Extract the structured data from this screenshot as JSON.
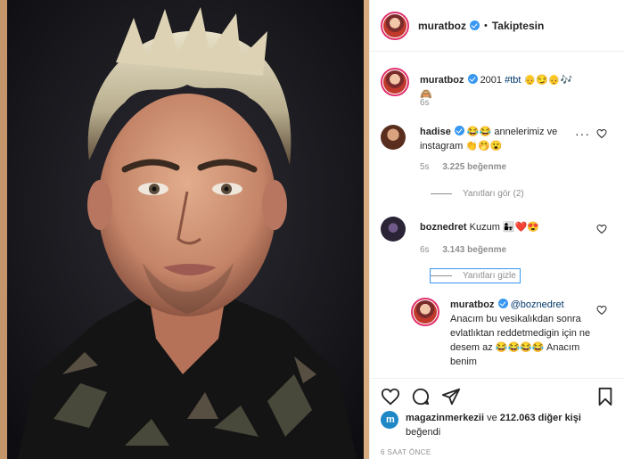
{
  "header": {
    "username": "muratboz",
    "separator": "•",
    "follow_label": "Takiptesin"
  },
  "caption": {
    "username": "muratboz",
    "text": "2001",
    "hashtag": "#tbt",
    "emoji": "👴😏👴🎶 🙈",
    "time": "6s"
  },
  "comments": [
    {
      "username": "hadise",
      "verified": true,
      "text": "😂😂 annelerimiz ve instagram 👏🤭😮",
      "time": "5s",
      "likes": "3.225 beğenme",
      "replies": "Yanıtları gör (2)"
    },
    {
      "username": "boznedret",
      "verified": false,
      "text": "Kuzum 👩‍👧❤️😍",
      "time": "6s",
      "likes": "3.143 beğenme",
      "replies": "Yanıtları gizle"
    }
  ],
  "reply": {
    "username": "muratboz",
    "mention": "@boznedret",
    "text": "Anacım bu vesikalıkdan sonra evlatlıktan reddetmedigin için ne desem az 😂😂😂😂 Anacım",
    "cut_line": "benim"
  },
  "footer": {
    "liked_by_user": "magazinmerkezii",
    "liked_connector": "ve",
    "liked_count": "212.063 diğer kişi",
    "liked_suffix": "beğendi",
    "time_ago": "6 SAAT ÖNCE"
  },
  "colors": {
    "verified_blue": "#3897f0",
    "story_ring": "#e1306c",
    "hashtag": "#00376b",
    "muted": "#8e8e8e"
  },
  "icons": [
    "heart-icon",
    "comment-icon",
    "share-icon",
    "bookmark-icon",
    "more-options-icon"
  ]
}
